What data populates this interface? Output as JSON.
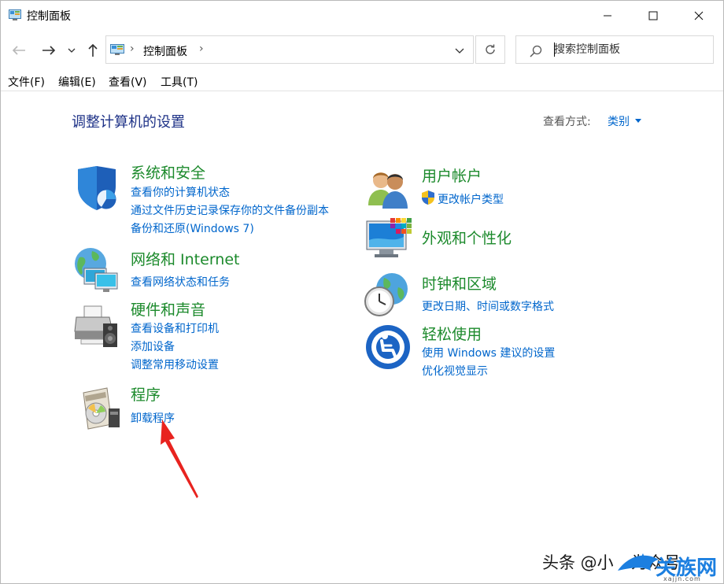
{
  "window": {
    "title": "控制面板",
    "buttons": {
      "minimize": "minimize-icon",
      "maximize": "maximize-icon",
      "close": "close-icon"
    }
  },
  "nav": {
    "back": "back-arrow-icon",
    "forward": "forward-arrow-icon",
    "recent": "chevron-down-icon",
    "up": "up-arrow-icon",
    "address": {
      "path": "控制面板"
    },
    "refresh": "refresh-icon",
    "search": {
      "placeholder": "搜索控制面板",
      "value": ""
    }
  },
  "menu": [
    "文件(F)",
    "编辑(E)",
    "查看(V)",
    "工具(T)"
  ],
  "main": {
    "title": "调整计算机的设置",
    "view_by_label": "查看方式:",
    "view_by_value": "类别",
    "categories": [
      {
        "title": "系统和安全",
        "icon": "shield-icon",
        "links": [
          "查看你的计算机状态",
          "通过文件历史记录保存你的文件备份副本",
          "备份和还原(Windows 7)"
        ]
      },
      {
        "title": "网络和 Internet",
        "icon": "network-globe-icon",
        "links": [
          "查看网络状态和任务"
        ]
      },
      {
        "title": "硬件和声音",
        "icon": "printer-speaker-icon",
        "links": [
          "查看设备和打印机",
          "添加设备",
          "调整常用移动设置"
        ]
      },
      {
        "title": "程序",
        "icon": "programs-disc-icon",
        "links": [
          "卸载程序"
        ]
      },
      {
        "title": "用户帐户",
        "icon": "users-icon",
        "links": [
          "更改帐户类型"
        ],
        "link_icon": "uac-shield-icon"
      },
      {
        "title": "外观和个性化",
        "icon": "monitor-palette-icon",
        "links": []
      },
      {
        "title": "时钟和区域",
        "icon": "clock-globe-icon",
        "links": [
          "更改日期、时间或数字格式"
        ]
      },
      {
        "title": "轻松使用",
        "icon": "ease-of-access-icon",
        "links": [
          "使用 Windows 建议的设置",
          "优化视觉显示"
        ]
      }
    ]
  },
  "annotation": {
    "arrow_color": "#e8231f",
    "points_to": "卸载程序"
  },
  "watermark": {
    "text": "头条 @小",
    "text_tail": "为众号",
    "logo_text": "关族网",
    "logo_url": "xajjn.com"
  },
  "colors": {
    "title": "#1e3287",
    "category": "#1c8a2c",
    "link": "#0066cc"
  }
}
